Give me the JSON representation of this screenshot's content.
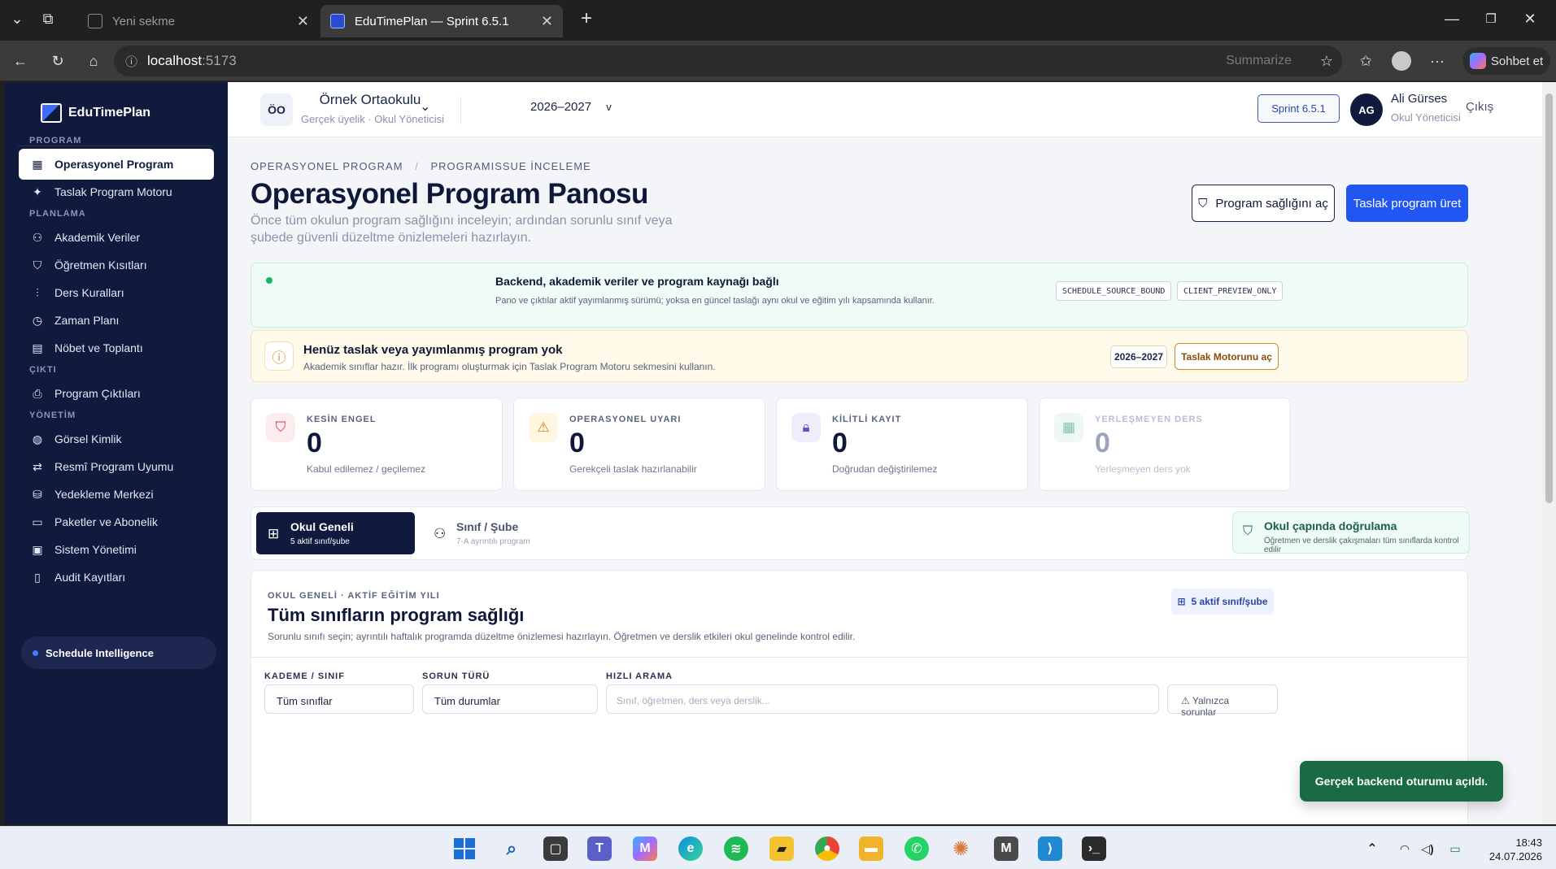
{
  "browser": {
    "tab_inactive_title": "Yeni sekme",
    "tab_active_title": "EduTimePlan — Sprint 6.5.1",
    "url_host": "localhost",
    "url_port": ":5173",
    "summarize_label": "Summarize",
    "copilot_label": "Sohbet et"
  },
  "sidebar": {
    "brand": "EduTimePlan",
    "sections": {
      "program": "PROGRAM",
      "planlama": "PLANLAMA",
      "cikti": "ÇIKTI",
      "yonetim": "YÖNETİM"
    },
    "items": [
      {
        "label": "Operasyonel Program",
        "icon": "calendar-icon",
        "active": true
      },
      {
        "label": "Taslak Program Motoru",
        "icon": "sparkles-icon"
      },
      {
        "label": "Akademik Veriler",
        "icon": "users-icon"
      },
      {
        "label": "Öğretmen Kısıtları",
        "icon": "shield-icon"
      },
      {
        "label": "Ders Kuralları",
        "icon": "sliders-icon"
      },
      {
        "label": "Zaman Planı",
        "icon": "clock-icon"
      },
      {
        "label": "Nöbet ve Toplantı",
        "icon": "clipboard-icon"
      },
      {
        "label": "Program Çıktıları",
        "icon": "printer-icon"
      },
      {
        "label": "Görsel Kimlik",
        "icon": "palette-icon"
      },
      {
        "label": "Resmî Program Uyumu",
        "icon": "swap-icon"
      },
      {
        "label": "Yedekleme Merkezi",
        "icon": "database-icon"
      },
      {
        "label": "Paketler ve Abonelik",
        "icon": "card-icon"
      },
      {
        "label": "Sistem Yönetimi",
        "icon": "monitor-icon"
      },
      {
        "label": "Audit Kayıtları",
        "icon": "file-icon"
      }
    ],
    "footer": "Schedule Intelligence"
  },
  "topbar": {
    "school_badge": "ÖO",
    "school_name": "Örnek Ortaokulu",
    "school_sub": "Gerçek üyelik · Okul Yöneticisi",
    "year": "2026–2027",
    "year_caret": "v",
    "sprint": "Sprint 6.5.1",
    "avatar": "AG",
    "user_name": "Ali Gürses",
    "user_role": "Okul Yöneticisi",
    "logout": "Çıkış"
  },
  "page": {
    "breadcrumb_1": "OPERASYONEL PROGRAM",
    "breadcrumb_sep": "/",
    "breadcrumb_2": "PROGRAMISSUE İNCELEME",
    "title": "Operasyonel Program Panosu",
    "description": "Önce tüm okulun program sağlığını inceleyin; ardından sorunlu sınıf veya şubede güvenli düzeltme önizlemeleri hazırlayın.",
    "btn_health": "Program sağlığını aç",
    "btn_generate": "Taslak program üret"
  },
  "status": {
    "title": "Backend, akademik veriler ve program kaynağı bağlı",
    "desc": "Pano ve çıktılar aktif yayımlanmış sürümü; yoksa en güncel taslağı aynı okul ve eğitim yılı kapsamında kullanır.",
    "tag_1": "SCHEDULE_SOURCE_BOUND",
    "tag_2": "CLIENT_PREVIEW_ONLY"
  },
  "warning": {
    "title": "Henüz taslak veya yayımlanmış program yok",
    "desc": "Akademik sınıflar hazır. İlk programı oluşturmak için Taslak Program Motoru sekmesini kullanın.",
    "year": "2026–2027",
    "button": "Taslak Motorunu aç"
  },
  "kpis": [
    {
      "label": "KESİN ENGEL",
      "value": "0",
      "desc": "Kabul edilemez / geçilemez",
      "icon": "shield-alert-icon",
      "color": "#d9364a"
    },
    {
      "label": "OPERASYONEL UYARI",
      "value": "0",
      "desc": "Gerekçeli taslak hazırlanabilir",
      "icon": "warning-triangle-icon",
      "color": "#d08a10"
    },
    {
      "label": "KİLİTLİ KAYIT",
      "value": "0",
      "desc": "Doğrudan değiştirilemez",
      "icon": "lock-icon",
      "color": "#6b4fc7"
    },
    {
      "label": "YERLEŞMEYEN DERS",
      "value": "0",
      "desc": "Yerleşmeyen ders yok",
      "icon": "calendar-icon",
      "color": "#3a9e7a"
    }
  ],
  "views": {
    "school": {
      "label": "Okul Geneli",
      "sub": "5 aktif sınıf/şube"
    },
    "class": {
      "label": "Sınıf / Şube",
      "sub": "7-A ayrıntılı program"
    },
    "validate_title": "Okul çapında doğrulama",
    "validate_desc": "Öğretmen ve derslik çakışmaları tüm sınıflarda kontrol edilir"
  },
  "health": {
    "section": "OKUL GENELİ · AKTİF EĞİTİM YILI",
    "title": "Tüm sınıfların program sağlığı",
    "desc": "Sorunlu sınıfı seçin; ayrıntılı haftalık programda düzeltme önizlemesi hazırlayın. Öğretmen ve derslik etkileri okul genelinde kontrol edilir.",
    "count": "5 aktif sınıf/şube",
    "filter_level_label": "KADEME / SINIF",
    "filter_level_value": "Tüm sınıflar",
    "filter_issue_label": "SORUN TÜRÜ",
    "filter_issue_value": "Tüm durumlar",
    "search_label": "HIZLI ARAMA",
    "search_placeholder": "Sınıf, öğretmen, ders veya derslik...",
    "only_issues": "Yalnızca sorunlar"
  },
  "toast": "Gerçek backend oturumu açıldı.",
  "taskbar": {
    "time": "18:43",
    "date": "24.07.2026"
  }
}
